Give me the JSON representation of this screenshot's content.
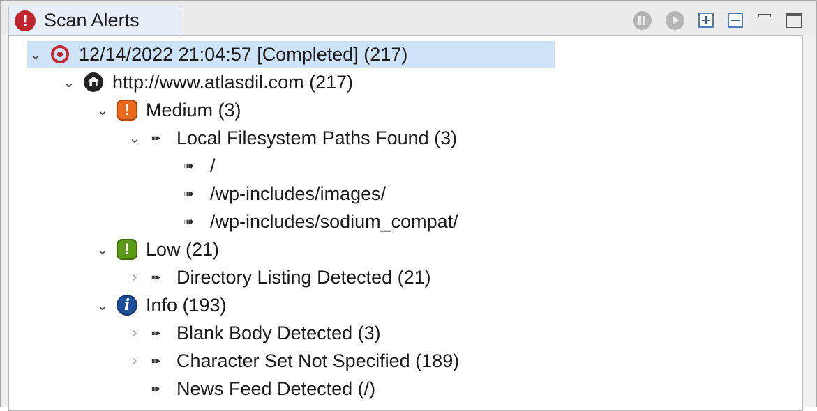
{
  "window": {
    "tab_title": "Scan Alerts",
    "tab_icon": "alert-icon",
    "accent_color": "#c0262b"
  },
  "toolbar": {
    "buttons": [
      {
        "name": "pause-icon"
      },
      {
        "name": "resume-icon"
      },
      {
        "name": "expand-all-icon"
      },
      {
        "name": "collapse-all-icon"
      },
      {
        "name": "minimize-icon"
      },
      {
        "name": "maximize-icon"
      }
    ]
  },
  "tree": {
    "scan": {
      "label": "12/14/2022 21:04:57 [Completed]  (217)",
      "icon": "scan-target-icon",
      "expanded": true
    },
    "site": {
      "label": "http://www.atlasdil.com (217)",
      "icon": "site-icon",
      "expanded": true
    },
    "medium": {
      "label": "Medium (3)",
      "icon": "medium-severity-icon",
      "color": "#ea6a1c",
      "expanded": true,
      "alerts": [
        {
          "label": "Local Filesystem Paths Found (3)",
          "expanded": true,
          "instances": [
            {
              "label": "/"
            },
            {
              "label": "/wp-includes/images/"
            },
            {
              "label": "/wp-includes/sodium_compat/"
            }
          ]
        }
      ]
    },
    "low": {
      "label": "Low (21)",
      "icon": "low-severity-icon",
      "color": "#5a9a16",
      "expanded": true,
      "alerts": [
        {
          "label": "Directory Listing Detected (21)",
          "expanded": false
        }
      ]
    },
    "info": {
      "label": "Info (193)",
      "icon": "info-severity-icon",
      "color": "#1e4f9d",
      "expanded": true,
      "alerts": [
        {
          "label": "Blank Body Detected (3)",
          "expanded": false
        },
        {
          "label": "Character Set Not Specified  (189)",
          "expanded": false
        },
        {
          "label": "News Feed Detected (/)",
          "expanded": false,
          "leaf": true
        }
      ]
    }
  }
}
